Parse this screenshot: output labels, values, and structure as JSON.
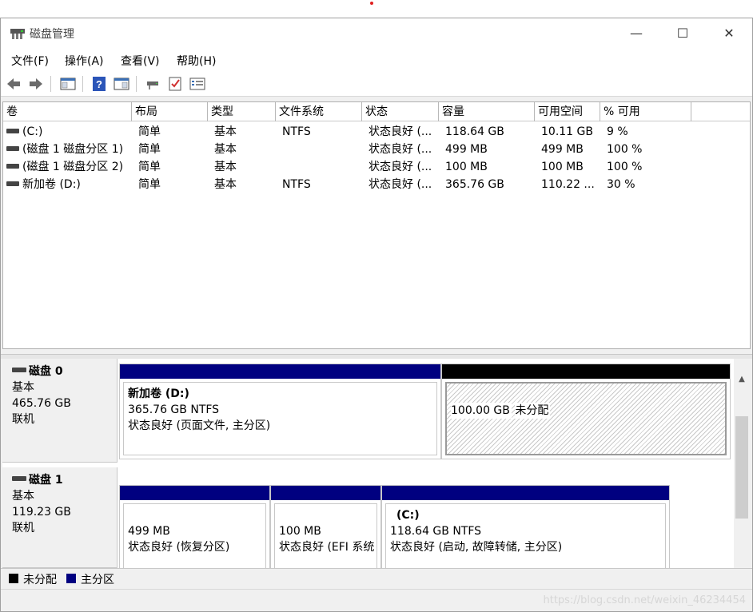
{
  "window": {
    "title": "磁盘管理"
  },
  "controls": {
    "minimize": "—",
    "maximize": "☐",
    "close": "✕"
  },
  "menu": {
    "file": "文件(F)",
    "action": "操作(A)",
    "view": "查看(V)",
    "help": "帮助(H)"
  },
  "table": {
    "headers": [
      "卷",
      "布局",
      "类型",
      "文件系统",
      "状态",
      "容量",
      "可用空间",
      "% 可用"
    ],
    "rows": [
      [
        "(C:)",
        "简单",
        "基本",
        "NTFS",
        "状态良好 (...",
        "118.64 GB",
        "10.11 GB",
        "9 %"
      ],
      [
        "(磁盘 1 磁盘分区 1)",
        "简单",
        "基本",
        "",
        "状态良好 (...",
        "499 MB",
        "499 MB",
        "100 %"
      ],
      [
        "(磁盘 1 磁盘分区 2)",
        "简单",
        "基本",
        "",
        "状态良好 (...",
        "100 MB",
        "100 MB",
        "100 %"
      ],
      [
        "新加卷 (D:)",
        "简单",
        "基本",
        "NTFS",
        "状态良好 (...",
        "365.76 GB",
        "110.22 ...",
        "30 %"
      ]
    ]
  },
  "disks": [
    {
      "name": "磁盘 0",
      "type": "基本",
      "size": "465.76 GB",
      "status": "联机",
      "partitions": [
        {
          "title": "新加卷  (D:)",
          "line1": "365.76 GB NTFS",
          "line2": "状态良好 (页面文件, 主分区)"
        },
        {
          "title": "",
          "line1": "100.00 GB",
          "line2": "未分配"
        }
      ]
    },
    {
      "name": "磁盘 1",
      "type": "基本",
      "size": "119.23 GB",
      "status": "联机",
      "partitions": [
        {
          "title": "",
          "line1": "499 MB",
          "line2": "状态良好 (恢复分区)"
        },
        {
          "title": "",
          "line1": "100 MB",
          "line2": "状态良好 (EFI 系统"
        },
        {
          "title": "(C:)",
          "line1": "118.64 GB NTFS",
          "line2": "状态良好 (启动, 故障转储, 主分区)"
        }
      ]
    }
  ],
  "legend": {
    "unallocated": "未分配",
    "primary": "主分区"
  },
  "colors": {
    "primary": "#000080",
    "unallocated": "#000000"
  },
  "watermark": "https://blog.csdn.net/weixin_46234454"
}
